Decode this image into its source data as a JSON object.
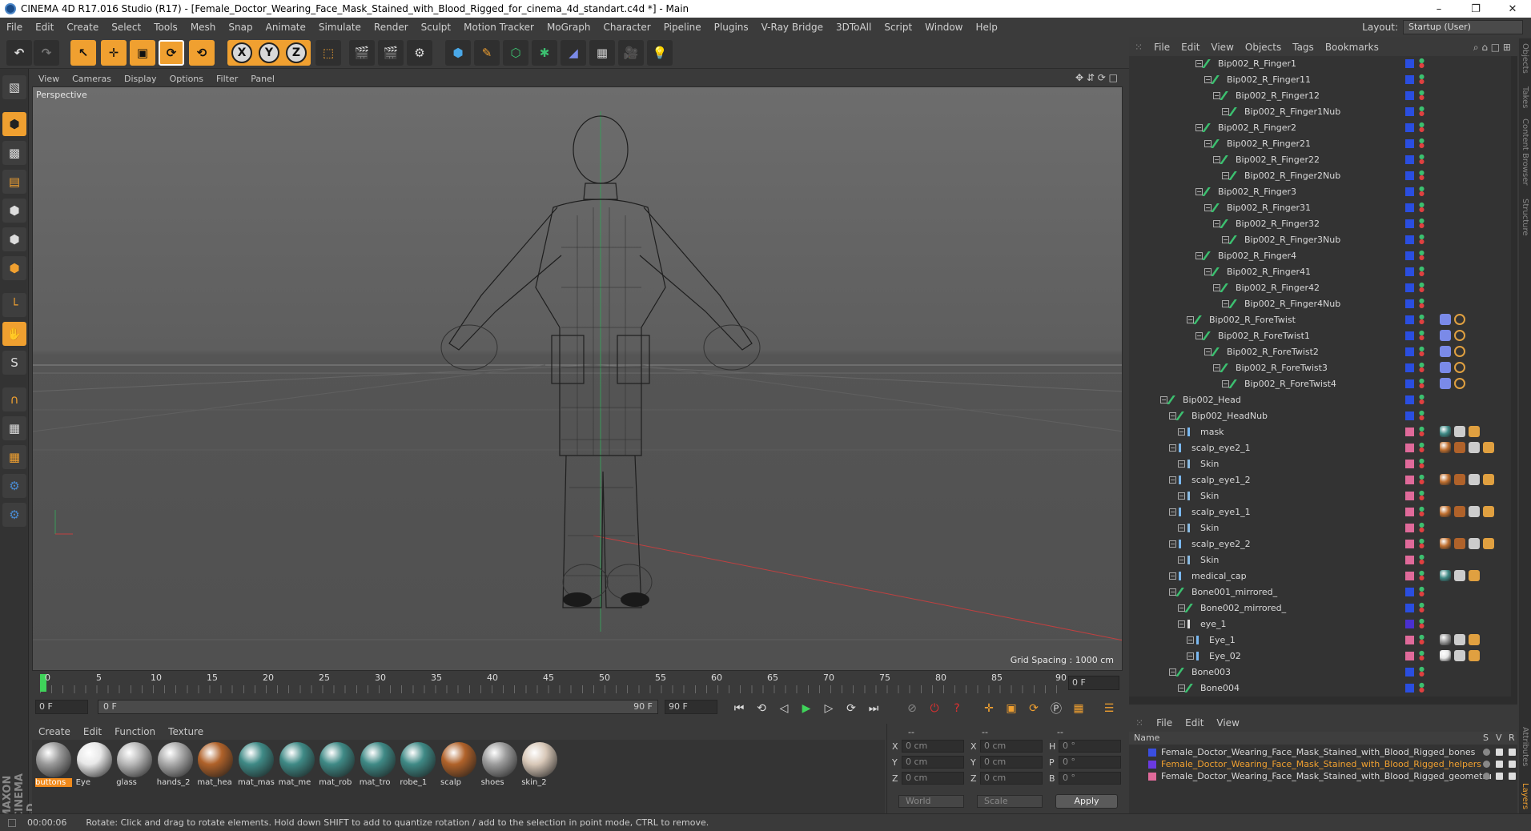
{
  "window": {
    "title": "CINEMA 4D R17.016 Studio (R17) - [Female_Doctor_Wearing_Face_Mask_Stained_with_Blood_Rigged_for_cinema_4d_standart.c4d *] - Main",
    "controls": [
      "–",
      "❐",
      "✕"
    ]
  },
  "menubar": {
    "items": [
      "File",
      "Edit",
      "Create",
      "Select",
      "Tools",
      "Mesh",
      "Snap",
      "Animate",
      "Simulate",
      "Render",
      "Sculpt",
      "Motion Tracker",
      "MoGraph",
      "Character",
      "Pipeline",
      "Plugins",
      "V-Ray Bridge",
      "3DToAll",
      "Script",
      "Window",
      "Help"
    ],
    "layout_label": "Layout:",
    "layout_value": "Startup (User)"
  },
  "toolbar": {
    "axis_labels": [
      "X",
      "Y",
      "Z"
    ]
  },
  "viewport": {
    "menu": [
      "View",
      "Cameras",
      "Display",
      "Options",
      "Filter",
      "Panel"
    ],
    "camera_label": "Perspective",
    "grid_spacing": "Grid Spacing : 1000 cm"
  },
  "timeline": {
    "ticks": [
      "0",
      "5",
      "10",
      "15",
      "20",
      "25",
      "30",
      "35",
      "40",
      "45",
      "50",
      "55",
      "60",
      "65",
      "70",
      "75",
      "80",
      "85",
      "90"
    ],
    "current_frame": "0 F",
    "start_field": "0 F",
    "range_start": "0 F",
    "range_end": "90 F",
    "end_field": "90 F"
  },
  "materials": {
    "menu": [
      "Create",
      "Edit",
      "Function",
      "Texture"
    ],
    "items": [
      {
        "label": "buttons",
        "color": "#9a9a9a",
        "selected": true
      },
      {
        "label": "Eye",
        "color": "#e8e8e8",
        "selected": false
      },
      {
        "label": "glass",
        "color": "#b8b8b8",
        "selected": false
      },
      {
        "label": "hands_2",
        "color": "#aaaaaa",
        "selected": false
      },
      {
        "label": "mat_hea",
        "color": "#b0622a",
        "selected": false
      },
      {
        "label": "mat_mas",
        "color": "#3f8a86",
        "selected": false
      },
      {
        "label": "mat_me",
        "color": "#3f8a86",
        "selected": false
      },
      {
        "label": "mat_rob",
        "color": "#3f8a86",
        "selected": false
      },
      {
        "label": "mat_tro",
        "color": "#3f8a86",
        "selected": false
      },
      {
        "label": "robe_1",
        "color": "#3f8a86",
        "selected": false
      },
      {
        "label": "scalp",
        "color": "#b0622a",
        "selected": false
      },
      {
        "label": "shoes",
        "color": "#9c9c9c",
        "selected": false
      },
      {
        "label": "skin_2",
        "color": "#d8c8b8",
        "selected": false
      }
    ]
  },
  "coordinates": {
    "headers": [
      "--",
      "--",
      "--"
    ],
    "rows": [
      {
        "a": "X",
        "av": "0 cm",
        "b": "X",
        "bv": "0 cm",
        "c": "H",
        "cv": "0 °"
      },
      {
        "a": "Y",
        "av": "0 cm",
        "b": "Y",
        "bv": "0 cm",
        "c": "P",
        "cv": "0 °"
      },
      {
        "a": "Z",
        "av": "0 cm",
        "b": "Z",
        "bv": "0 cm",
        "c": "B",
        "cv": "0 °"
      }
    ],
    "world": "World",
    "scale": "Scale",
    "apply": "Apply"
  },
  "status": {
    "time": "00:00:06",
    "message": "Rotate: Click and drag to rotate elements. Hold down SHIFT to add to quantize rotation / add to the selection in point mode, CTRL to remove."
  },
  "object_manager": {
    "menu": [
      "File",
      "Edit",
      "View",
      "Objects",
      "Tags",
      "Bookmarks"
    ],
    "rows": [
      {
        "name": "Bip002_R_Finger1",
        "depth": 5,
        "icon": "bone",
        "layer": "#2a4ee0",
        "tags": ""
      },
      {
        "name": "Bip002_R_Finger11",
        "depth": 6,
        "icon": "bone",
        "layer": "#2a4ee0",
        "tags": ""
      },
      {
        "name": "Bip002_R_Finger12",
        "depth": 7,
        "icon": "bone",
        "layer": "#2a4ee0",
        "tags": ""
      },
      {
        "name": "Bip002_R_Finger1Nub",
        "depth": 8,
        "icon": "bone",
        "layer": "#2a4ee0",
        "tags": ""
      },
      {
        "name": "Bip002_R_Finger2",
        "depth": 5,
        "icon": "bone",
        "layer": "#2a4ee0",
        "tags": ""
      },
      {
        "name": "Bip002_R_Finger21",
        "depth": 6,
        "icon": "bone",
        "layer": "#2a4ee0",
        "tags": ""
      },
      {
        "name": "Bip002_R_Finger22",
        "depth": 7,
        "icon": "bone",
        "layer": "#2a4ee0",
        "tags": ""
      },
      {
        "name": "Bip002_R_Finger2Nub",
        "depth": 8,
        "icon": "bone",
        "layer": "#2a4ee0",
        "tags": ""
      },
      {
        "name": "Bip002_R_Finger3",
        "depth": 5,
        "icon": "bone",
        "layer": "#2a4ee0",
        "tags": ""
      },
      {
        "name": "Bip002_R_Finger31",
        "depth": 6,
        "icon": "bone",
        "layer": "#2a4ee0",
        "tags": ""
      },
      {
        "name": "Bip002_R_Finger32",
        "depth": 7,
        "icon": "bone",
        "layer": "#2a4ee0",
        "tags": ""
      },
      {
        "name": "Bip002_R_Finger3Nub",
        "depth": 8,
        "icon": "bone",
        "layer": "#2a4ee0",
        "tags": ""
      },
      {
        "name": "Bip002_R_Finger4",
        "depth": 5,
        "icon": "bone",
        "layer": "#2a4ee0",
        "tags": ""
      },
      {
        "name": "Bip002_R_Finger41",
        "depth": 6,
        "icon": "bone",
        "layer": "#2a4ee0",
        "tags": ""
      },
      {
        "name": "Bip002_R_Finger42",
        "depth": 7,
        "icon": "bone",
        "layer": "#2a4ee0",
        "tags": ""
      },
      {
        "name": "Bip002_R_Finger4Nub",
        "depth": 8,
        "icon": "bone",
        "layer": "#2a4ee0",
        "tags": ""
      },
      {
        "name": "Bip002_R_ForeTwist",
        "depth": 4,
        "icon": "bone",
        "layer": "#2a4ee0",
        "tags": "constraint"
      },
      {
        "name": "Bip002_R_ForeTwist1",
        "depth": 5,
        "icon": "bone",
        "layer": "#2a4ee0",
        "tags": "constraint"
      },
      {
        "name": "Bip002_R_ForeTwist2",
        "depth": 6,
        "icon": "bone",
        "layer": "#2a4ee0",
        "tags": "constraint"
      },
      {
        "name": "Bip002_R_ForeTwist3",
        "depth": 7,
        "icon": "bone",
        "layer": "#2a4ee0",
        "tags": "constraint"
      },
      {
        "name": "Bip002_R_ForeTwist4",
        "depth": 8,
        "icon": "bone",
        "layer": "#2a4ee0",
        "tags": "constraint"
      },
      {
        "name": "Bip002_Head",
        "depth": 1,
        "icon": "bone",
        "layer": "#2a4ee0",
        "tags": ""
      },
      {
        "name": "Bip002_HeadNub",
        "depth": 2,
        "icon": "bone",
        "layer": "#2a4ee0",
        "tags": ""
      },
      {
        "name": "mask",
        "depth": 3,
        "icon": "poly",
        "layer": "#e06a9a",
        "tags": "mat-teal"
      },
      {
        "name": "scalp_eye2_1",
        "depth": 2,
        "icon": "poly",
        "layer": "#e06a9a",
        "tags": "mat-orange"
      },
      {
        "name": "Skin",
        "depth": 3,
        "icon": "skin",
        "layer": "#e06a9a",
        "tags": ""
      },
      {
        "name": "scalp_eye1_2",
        "depth": 2,
        "icon": "poly",
        "layer": "#e06a9a",
        "tags": "mat-orange"
      },
      {
        "name": "Skin",
        "depth": 3,
        "icon": "skin",
        "layer": "#e06a9a",
        "tags": ""
      },
      {
        "name": "scalp_eye1_1",
        "depth": 2,
        "icon": "poly",
        "layer": "#e06a9a",
        "tags": "mat-orange"
      },
      {
        "name": "Skin",
        "depth": 3,
        "icon": "skin",
        "layer": "#e06a9a",
        "tags": ""
      },
      {
        "name": "scalp_eye2_2",
        "depth": 2,
        "icon": "poly",
        "layer": "#e06a9a",
        "tags": "mat-orange"
      },
      {
        "name": "Skin",
        "depth": 3,
        "icon": "skin",
        "layer": "#e06a9a",
        "tags": ""
      },
      {
        "name": "medical_cap",
        "depth": 2,
        "icon": "poly",
        "layer": "#e06a9a",
        "tags": "mat-teal"
      },
      {
        "name": "Bone001_mirrored_",
        "depth": 2,
        "icon": "bone",
        "layer": "#2a4ee0",
        "tags": ""
      },
      {
        "name": "Bone002_mirrored_",
        "depth": 3,
        "icon": "bone",
        "layer": "#2a4ee0",
        "tags": ""
      },
      {
        "name": "eye_1",
        "depth": 3,
        "icon": "null",
        "layer": "#4a30d0",
        "tags": ""
      },
      {
        "name": "Eye_1",
        "depth": 4,
        "icon": "poly",
        "layer": "#e06a9a",
        "tags": "mat-grey"
      },
      {
        "name": "Eye_02",
        "depth": 4,
        "icon": "poly",
        "layer": "#e06a9a",
        "tags": "mat-eye"
      },
      {
        "name": "Bone003",
        "depth": 2,
        "icon": "bone",
        "layer": "#2a4ee0",
        "tags": ""
      },
      {
        "name": "Bone004",
        "depth": 3,
        "icon": "bone",
        "layer": "#2a4ee0",
        "tags": ""
      }
    ]
  },
  "layers": {
    "menu": [
      "File",
      "Edit",
      "View"
    ],
    "headers": {
      "name": "Name",
      "s": "S",
      "v": "V",
      "r": "R"
    },
    "items": [
      {
        "name": "Female_Doctor_Wearing_Face_Mask_Stained_with_Blood_Rigged_bones",
        "color": "#3a4ee0",
        "highlight": false
      },
      {
        "name": "Female_Doctor_Wearing_Face_Mask_Stained_with_Blood_Rigged_helpers",
        "color": "#6a3ae0",
        "highlight": true
      },
      {
        "name": "Female_Doctor_Wearing_Face_Mask_Stained_with_Blood_Rigged_geometru",
        "color": "#e06a9a",
        "highlight": false
      }
    ]
  },
  "right_tabs": [
    "Objects",
    "Takes",
    "Content Browser",
    "Structure",
    "Attributes",
    "Layers"
  ],
  "colors": {
    "accent": "#f0a030",
    "layer_highlight": "#f0a030"
  }
}
